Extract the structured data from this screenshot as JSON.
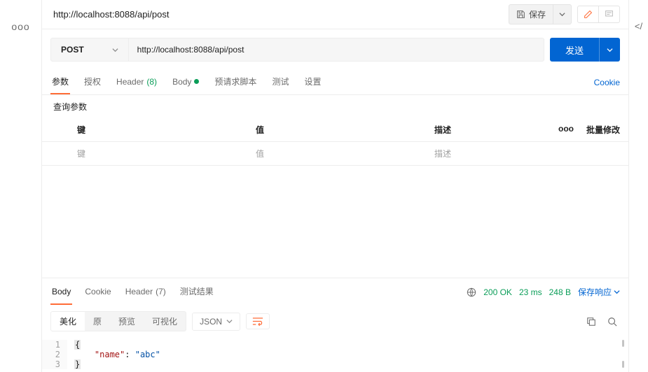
{
  "tab": {
    "title": "http://localhost:8088/api/post"
  },
  "actions": {
    "save": "保存",
    "send": "发送"
  },
  "request": {
    "method": "POST",
    "url": "http://localhost:8088/api/post",
    "tabs": {
      "params": "参数",
      "auth": "授权",
      "headers_label": "Header",
      "headers_count": "(8)",
      "body": "Body",
      "prereq": "预请求脚本",
      "tests": "测试",
      "settings": "设置"
    },
    "cookie_link": "Cookie",
    "query_heading": "查询参数",
    "param_headers": {
      "key": "键",
      "value": "值",
      "desc": "描述",
      "bulk": "批量修改",
      "more": "ooo"
    },
    "param_placeholders": {
      "key": "键",
      "value": "值",
      "desc": "描述"
    }
  },
  "response": {
    "tabs": {
      "body": "Body",
      "cookie": "Cookie",
      "headers_label": "Header",
      "headers_count": "(7)",
      "test_results": "测试结果"
    },
    "status": "200 OK",
    "time": "23 ms",
    "size": "248 B",
    "save_label": "保存响应",
    "view_tabs": {
      "pretty": "美化",
      "raw": "原",
      "preview": "预览",
      "visualize": "可视化"
    },
    "format": "JSON"
  },
  "body_content": {
    "lines": [
      "1",
      "2",
      "3"
    ],
    "open_brace": "{",
    "kv_key": "\"name\"",
    "kv_sep": ": ",
    "kv_val": "\"abc\"",
    "close_brace": "}"
  }
}
